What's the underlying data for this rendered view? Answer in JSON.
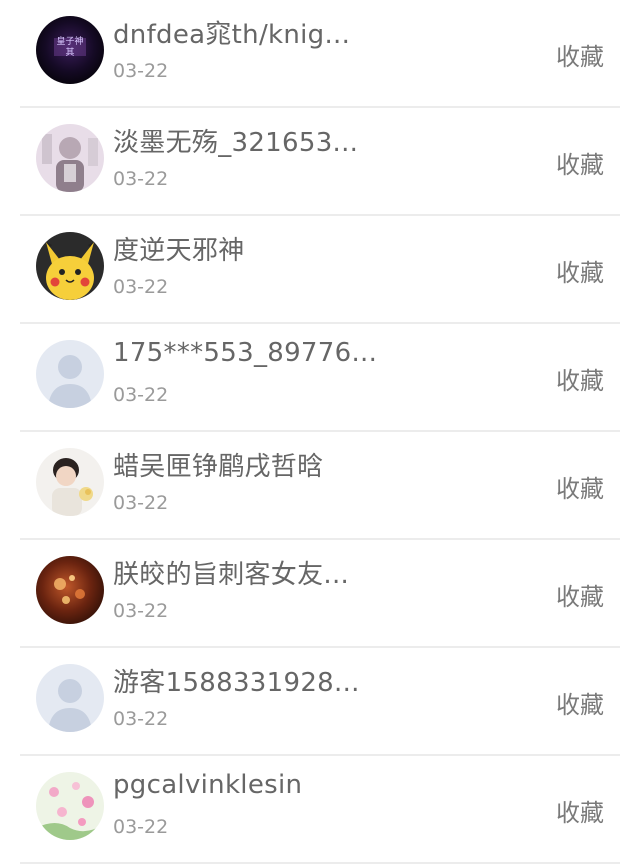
{
  "users": [
    {
      "name": "dnfdea窕th/knig...",
      "date": "03-22",
      "action": "收藏",
      "avatar": "dark-gradient-avatar",
      "avatar_caption": "皇子神\n其"
    },
    {
      "name": "淡墨无殇_321653...",
      "date": "03-22",
      "action": "收藏",
      "avatar": "person-photo-avatar"
    },
    {
      "name": "度逆天邪神",
      "date": "03-22",
      "action": "收藏",
      "avatar": "pikachu-avatar"
    },
    {
      "name": "175***553_89776...",
      "date": "03-22",
      "action": "收藏",
      "avatar": "default-user-avatar"
    },
    {
      "name": "蜡吴匣铮鹛戌哲晗",
      "date": "03-22",
      "action": "收藏",
      "avatar": "child-photo-avatar"
    },
    {
      "name": "朕皎的旨刺客女友...",
      "date": "03-22",
      "action": "收藏",
      "avatar": "warm-lights-avatar"
    },
    {
      "name": "游客1588331928...",
      "date": "03-22",
      "action": "收藏",
      "avatar": "default-user-avatar"
    },
    {
      "name": "pgcalvinklesin",
      "date": "03-22",
      "action": "收藏",
      "avatar": "flowers-avatar"
    }
  ]
}
